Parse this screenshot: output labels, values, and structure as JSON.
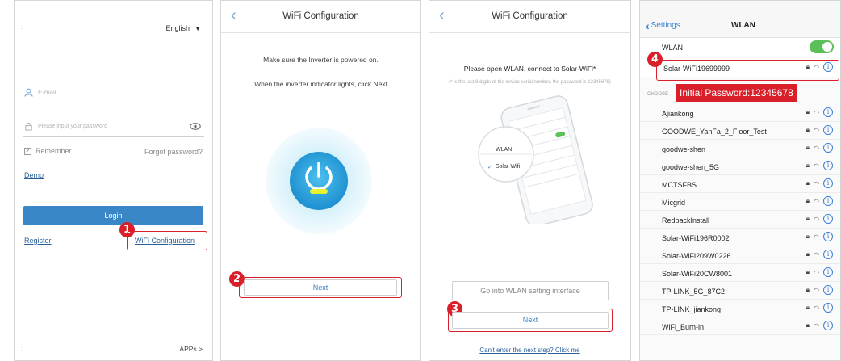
{
  "colors": {
    "accent_red": "#d9202a",
    "brand_blue": "#3a87c8",
    "ios_blue": "#3a7fd6",
    "toggle_green": "#5bc05a"
  },
  "login": {
    "language": "English",
    "email_placeholder": "E-mail",
    "password_placeholder": "Please input your password",
    "remember": "Remember",
    "forgot": "Forgot password?",
    "demo": "Demo",
    "login_button": "Login",
    "register": "Register",
    "wifi_config": "WiFi Configuration",
    "apps": "APPs >",
    "step_badge": "1"
  },
  "wifi_config": {
    "title": "WiFi Configuration",
    "line1": "Make sure the Inverter is powered on.",
    "line2": "When the inverter indicator lights, click Next",
    "next": "Next",
    "step_badge": "2",
    "icon": "power-icon"
  },
  "connect": {
    "title": "WiFi Configuration",
    "heading": "Please open WLAN, connect to Solar-WiFi*",
    "note": "(* is the last 8 digits of the device serial number, the password is 12345678)",
    "phone_wlan": "WLAN",
    "phone_solar": "Solar-Wifi",
    "go_wlan": "Go into WLAN setting interface",
    "next": "Next",
    "help": "Can't enter the next step? Click me",
    "step_badge": "3"
  },
  "wlan": {
    "back": "Settings",
    "title": "WLAN",
    "wlan_label": "WLAN",
    "connected": "Solar-WiFi19699999",
    "section": "CHOOSE",
    "password_note": "Initial Password:12345678",
    "step_badge": "4",
    "networks": [
      "Ajiankong",
      "GOODWE_YanFa_2_Floor_Test",
      "goodwe-shen",
      "goodwe-shen_5G",
      "MCTSFBS",
      "Micgrid",
      "RedbackInstall",
      "Solar-WiFi196R0002",
      "Solar-WiFi209W0226",
      "Solar-WiFi20CW8001",
      "TP-LINK_5G_87C2",
      "TP-LINK_jiankong",
      "WiFi_Burn-in"
    ]
  }
}
